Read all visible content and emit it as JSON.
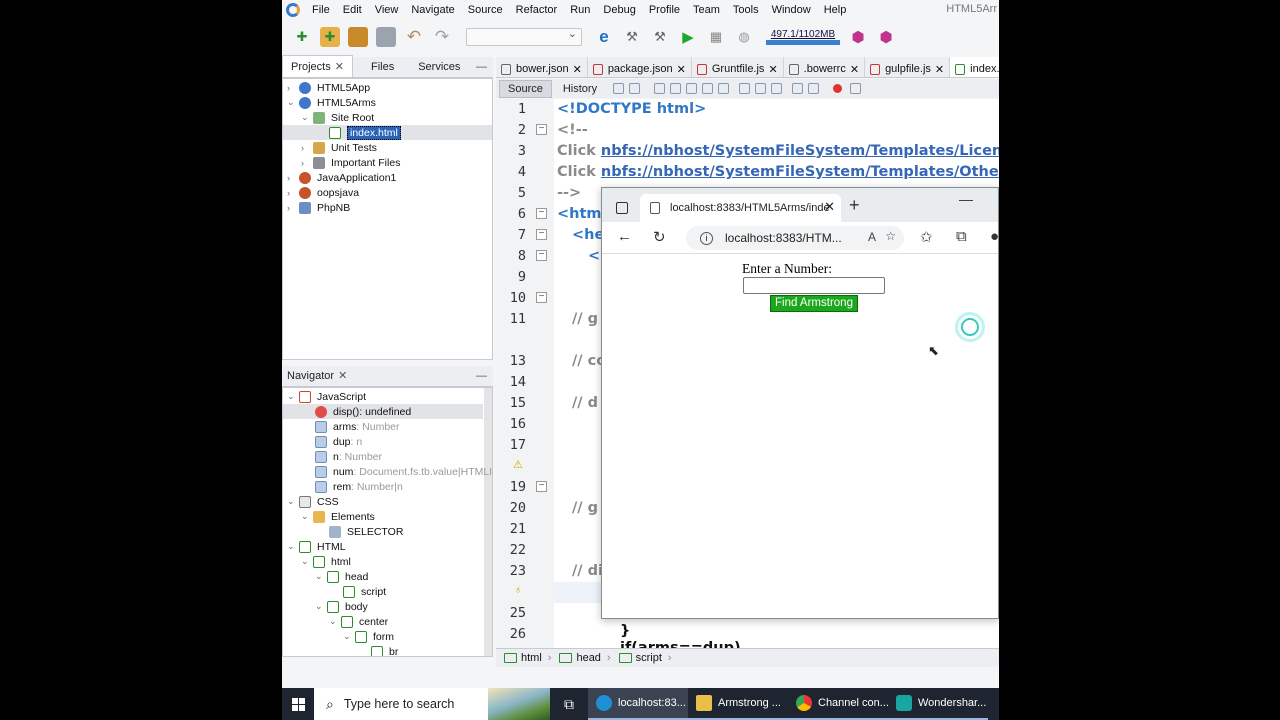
{
  "menubar": {
    "items": [
      "File",
      "Edit",
      "View",
      "Navigate",
      "Source",
      "Refactor",
      "Run",
      "Debug",
      "Profile",
      "Team",
      "Tools",
      "Window",
      "Help"
    ],
    "window_title": "HTML5Arr"
  },
  "toolbar": {
    "memory_label": "497.1/1102MB"
  },
  "projects_panel": {
    "tabs": [
      "Projects",
      "Files",
      "Services"
    ],
    "tree": [
      "HTML5App",
      "HTML5Arms",
      "Site Root",
      "index.html",
      "Unit Tests",
      "Important Files",
      "JavaApplication1",
      "oopsjava",
      "PhpNB"
    ]
  },
  "navigator": {
    "title": "Navigator",
    "items": [
      {
        "name": "JavaScript",
        "type": ""
      },
      {
        "name": "disp()",
        "type": " : undefined"
      },
      {
        "name": "arms",
        "type": " : Number"
      },
      {
        "name": "dup",
        "type": " : n"
      },
      {
        "name": "n",
        "type": " : Number"
      },
      {
        "name": "num",
        "type": " : Document.fs.tb.value|HTMLI"
      },
      {
        "name": "rem",
        "type": " : Number|n"
      },
      {
        "name": "CSS",
        "type": ""
      },
      {
        "name": "Elements",
        "type": ""
      },
      {
        "name": "SELECTOR",
        "type": ""
      },
      {
        "name": "HTML",
        "type": ""
      },
      {
        "name": "html",
        "type": ""
      },
      {
        "name": "head",
        "type": ""
      },
      {
        "name": "script",
        "type": ""
      },
      {
        "name": "body",
        "type": ""
      },
      {
        "name": "center",
        "type": ""
      },
      {
        "name": "form",
        "type": ""
      },
      {
        "name": "br",
        "type": ""
      }
    ]
  },
  "editor": {
    "tabs": [
      "bower.json",
      "package.json",
      "Gruntfile.js",
      ".bowerrc",
      "gulpfile.js",
      "index.html"
    ],
    "source_label": "Source",
    "history_label": "History",
    "line_numbers": [
      "1",
      "2",
      "3",
      "4",
      "5",
      "6",
      "7",
      "8",
      "9",
      "10",
      "11",
      "13",
      "14",
      "15",
      "16",
      "17",
      "19",
      "20",
      "21",
      "22",
      "23",
      "25",
      "26"
    ],
    "code": {
      "l1": "<!DOCTYPE html>",
      "l2": "<!--",
      "l3a": "Click ",
      "l3b": "nbfs://nbhost/SystemFileSystem/Templates/Licenses/lic",
      "l4a": "Click ",
      "l4b": "nbfs://nbhost/SystemFileSystem/Templates/Other/html.",
      "l5": "-->",
      "l6": "<html",
      "l7": "<he",
      "l8": "<",
      "l11": "// g",
      "l13": "// co",
      "l15": "// d",
      "l20": "// g",
      "l23": "// di",
      "l26": "}",
      "l27": "if(arms==dup)"
    },
    "breadcrumbs": [
      "html",
      "head",
      "script"
    ]
  },
  "browser": {
    "tab_title": "localhost:8383/HTML5Arms/inde",
    "address": "localhost:8383/HTM...",
    "page": {
      "label": "Enter a Number:",
      "input_value": "",
      "button_label": "Find Armstrong"
    }
  },
  "taskbar": {
    "search_placeholder": "Type here to search",
    "items": [
      "localhost:83...",
      "Armstrong ...",
      "Channel con...",
      "Wondershar..."
    ]
  }
}
